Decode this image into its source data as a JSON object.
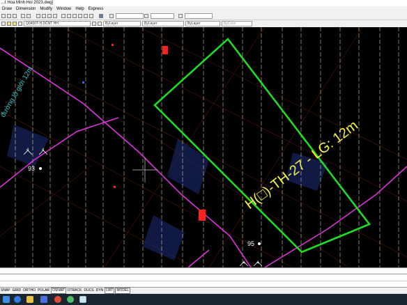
{
  "window": {
    "title": "...t Hoa Minh Hoi 2023.dwg]"
  },
  "menu": [
    "Draw",
    "Dimension",
    "Modify",
    "Window",
    "Help",
    "Express"
  ],
  "layer": {
    "name": "Q0400T-H.DCNT HH"
  },
  "properties": {
    "color": "ByLayer",
    "linetype": "ByLayer",
    "lineweight": "ByLayer",
    "plotstyle": "ByColor"
  },
  "drawing": {
    "lot_label": "H(□)-TH-27 - LG: 12m",
    "road_label": "đường lộ giới 12m",
    "point_labels": [
      "93",
      "95"
    ],
    "marker_labels": [
      "4",
      "4",
      "4",
      "4"
    ],
    "colors": {
      "boundary": "#22dd22",
      "road": "#dd33dd",
      "grid": "#e6d3a3",
      "label": "#f2f24a",
      "marker": "#ff2020",
      "cyan": "#3fc6c6"
    }
  },
  "statusbar": {
    "buttons": [
      "SNAP",
      "GRID",
      "ORTHO",
      "POLAR",
      "OSNAP",
      "OTRACK",
      "DUCS",
      "DYN",
      "LWT",
      "MODEL"
    ]
  },
  "taskbar": {
    "icons": [
      "windows-start-icon",
      "edge-browser-icon",
      "file-explorer-icon",
      "store-icon",
      "chrome-icon",
      "settings-icon",
      "autocad-icon"
    ]
  }
}
